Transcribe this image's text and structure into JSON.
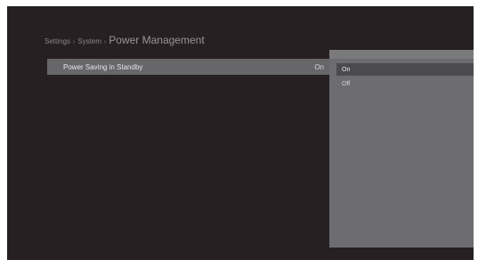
{
  "breadcrumb": {
    "level1": "Settings",
    "level2": "System",
    "current": "Power Management",
    "separator": "›"
  },
  "setting": {
    "label": "Power Saving in Standby",
    "value": "On"
  },
  "dropdown": {
    "options": [
      "On",
      "Off"
    ],
    "selected": "On"
  },
  "colors": {
    "screen_background": "#262022",
    "row_highlight": "#67676a",
    "dropdown_background": "#6d6d70",
    "option_highlight": "#4b4a4e"
  }
}
